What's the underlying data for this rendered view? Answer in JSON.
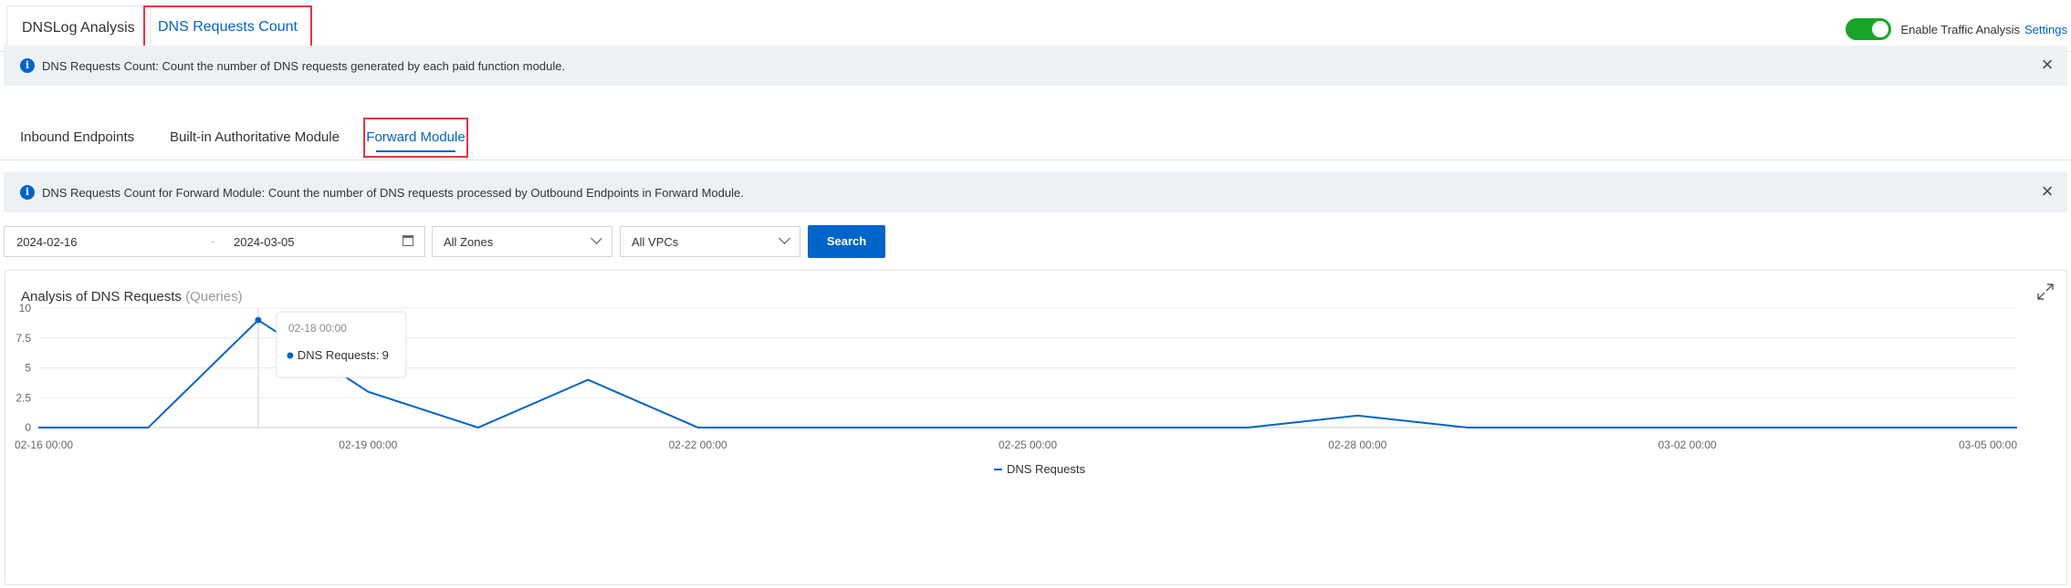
{
  "top_tabs": [
    {
      "label": "DNSLog Analysis"
    },
    {
      "label": "DNS Requests Count"
    }
  ],
  "traffic": {
    "toggle_on": true,
    "label": "Enable Traffic Analysis",
    "settings_link": "Settings"
  },
  "banner1": {
    "text": "DNS Requests Count: Count the number of DNS requests generated by each paid function module."
  },
  "sub_tabs": [
    {
      "label": "Inbound Endpoints"
    },
    {
      "label": "Built-in Authoritative Module"
    },
    {
      "label": "Forward Module"
    }
  ],
  "banner2": {
    "text": "DNS Requests Count for Forward Module: Count the number of DNS requests processed by Outbound Endpoints in Forward Module."
  },
  "filters": {
    "start_date": "2024-02-16",
    "separator": "-",
    "end_date": "2024-03-05",
    "zone_select": "All Zones",
    "vpc_select": "All VPCs",
    "search_label": "Search"
  },
  "panel": {
    "title": "Analysis of DNS Requests",
    "unit": "(Queries)"
  },
  "tooltip": {
    "title": "02-18 00:00",
    "series": "DNS Requests:",
    "value": "9"
  },
  "colors": {
    "accent": "#0064c8",
    "highlight_border": "#e3353f",
    "toggle_on": "#18a52a",
    "banner_bg": "#edf1f6"
  },
  "chart_data": {
    "type": "line",
    "title": "Analysis of DNS Requests",
    "subtitle": "(Queries)",
    "x": [
      "02-16 00:00",
      "02-17 00:00",
      "02-18 00:00",
      "02-19 00:00",
      "02-20 00:00",
      "02-21 00:00",
      "02-22 00:00",
      "02-23 00:00",
      "02-24 00:00",
      "02-25 00:00",
      "02-26 00:00",
      "02-27 00:00",
      "02-28 00:00",
      "02-29 00:00",
      "03-01 00:00",
      "03-02 00:00",
      "03-03 00:00",
      "03-04 00:00",
      "03-05 00:00"
    ],
    "x_tick_labels": [
      "02-16 00:00",
      "02-19 00:00",
      "02-22 00:00",
      "02-25 00:00",
      "02-28 00:00",
      "03-02 00:00",
      "03-05 00:00"
    ],
    "y_ticks": [
      "0",
      "2.5",
      "5",
      "7.5",
      "10"
    ],
    "ylim": [
      0,
      10
    ],
    "series": [
      {
        "name": "DNS Requests",
        "values": [
          0,
          0,
          9,
          3,
          0,
          4,
          0,
          0,
          0,
          0,
          0,
          0,
          1,
          0,
          0,
          0,
          0,
          0,
          0
        ]
      }
    ],
    "grid": true,
    "legend": "bottom-center",
    "highlight_index": 2
  }
}
